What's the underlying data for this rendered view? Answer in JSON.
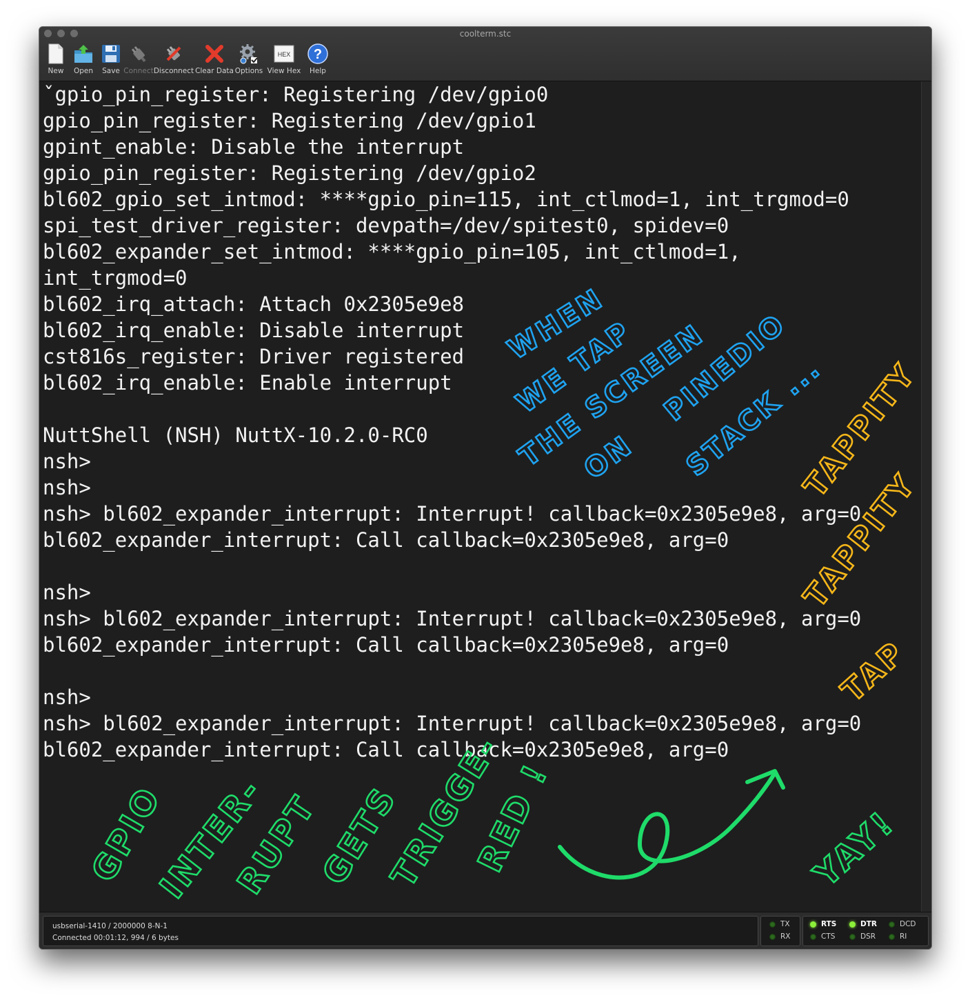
{
  "window": {
    "title": "coolterm.stc"
  },
  "toolbar": {
    "buttons": [
      {
        "label": "New",
        "icon": "new-document-icon",
        "enabled": true
      },
      {
        "label": "Open",
        "icon": "open-folder-icon",
        "enabled": true
      },
      {
        "label": "Save",
        "icon": "save-disk-icon",
        "enabled": true
      },
      {
        "label": "Connect",
        "icon": "connect-plug-icon",
        "enabled": false
      },
      {
        "label": "Disconnect",
        "icon": "disconnect-plug-icon",
        "enabled": true
      },
      {
        "label": "Clear Data",
        "icon": "clear-x-icon",
        "enabled": true
      },
      {
        "label": "Options",
        "icon": "options-gear-icon",
        "enabled": true
      },
      {
        "label": "View Hex",
        "icon": "hex-icon",
        "enabled": true
      },
      {
        "label": "Help",
        "icon": "help-question-icon",
        "enabled": true
      }
    ],
    "hex_icon_text": "HEX",
    "help_icon_text": "?"
  },
  "terminal": {
    "lines": [
      "ˇgpio_pin_register: Registering /dev/gpio0",
      "gpio_pin_register: Registering /dev/gpio1",
      "gpint_enable: Disable the interrupt",
      "gpio_pin_register: Registering /dev/gpio2",
      "bl602_gpio_set_intmod: ****gpio_pin=115, int_ctlmod=1, int_trgmod=0",
      "spi_test_driver_register: devpath=/dev/spitest0, spidev=0",
      "bl602_expander_set_intmod: ****gpio_pin=105, int_ctlmod=1,",
      "int_trgmod=0",
      "bl602_irq_attach: Attach 0x2305e9e8",
      "bl602_irq_enable: Disable interrupt",
      "cst816s_register: Driver registered",
      "bl602_irq_enable: Enable interrupt",
      "",
      "NuttShell (NSH) NuttX-10.2.0-RC0",
      "nsh>",
      "nsh>",
      "nsh> bl602_expander_interrupt: Interrupt! callback=0x2305e9e8, arg=0",
      "bl602_expander_interrupt: Call callback=0x2305e9e8, arg=0",
      "",
      "nsh>",
      "nsh> bl602_expander_interrupt: Interrupt! callback=0x2305e9e8, arg=0",
      "bl602_expander_interrupt: Call callback=0x2305e9e8, arg=0",
      "",
      "nsh>",
      "nsh> bl602_expander_interrupt: Interrupt! callback=0x2305e9e8, arg=0",
      "bl602_expander_interrupt: Call callback=0x2305e9e8, arg=0"
    ]
  },
  "status": {
    "port": "usbserial-1410 / 2000000 8-N-1",
    "connection": "Connected 00:01:12, 994 / 6 bytes",
    "leds": {
      "tx": {
        "label": "TX",
        "on": false
      },
      "rx": {
        "label": "RX",
        "on": false
      },
      "rts": {
        "label": "RTS",
        "on": true
      },
      "cts": {
        "label": "CTS",
        "on": false
      },
      "dtr": {
        "label": "DTR",
        "on": true
      },
      "dsr": {
        "label": "DSR",
        "on": false
      },
      "dcd": {
        "label": "DCD",
        "on": false
      },
      "ri": {
        "label": "RI",
        "on": false
      }
    }
  },
  "annotations": {
    "blue": [
      "WHEN",
      "WE TAP",
      "THE SCREEN",
      "ON",
      "PINEDIO",
      "STACK ..."
    ],
    "orange": [
      "TAPPITY",
      "TAPPITY",
      "TAP"
    ],
    "green": [
      "GPIO",
      "INTER-",
      "RUPT",
      "GETS",
      "TRIGGE-",
      "RED !",
      "YAY!"
    ],
    "colors": {
      "blue": "#1fa3f0",
      "orange": "#f6b71a",
      "green": "#1fdc6a"
    }
  }
}
